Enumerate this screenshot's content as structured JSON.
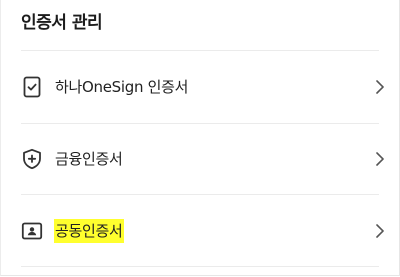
{
  "section": {
    "title": "인증서 관리"
  },
  "items": [
    {
      "label": "하나OneSign 인증서",
      "icon": "phone-check-icon",
      "highlighted": false
    },
    {
      "label": "금융인증서",
      "icon": "shield-plus-icon",
      "highlighted": false
    },
    {
      "label": "공동인증서",
      "icon": "id-card-icon",
      "highlighted": true
    }
  ],
  "colors": {
    "highlight": "#ffff2e",
    "divider": "#ebebeb",
    "text": "#222222"
  }
}
